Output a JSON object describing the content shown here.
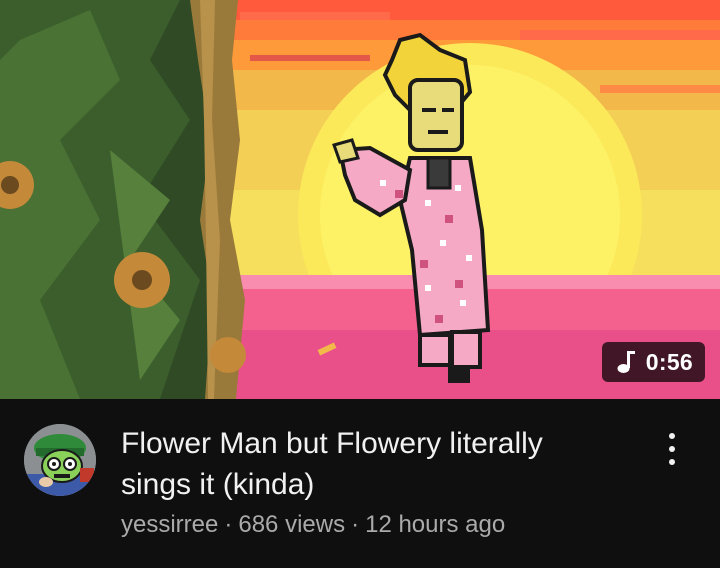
{
  "video": {
    "title": "Flower Man but Flowery literally sings it (kinda)",
    "duration": "0:56",
    "channel": "yessirree",
    "separator": "·",
    "views": "686 views",
    "uploaded": "12 hours ago"
  },
  "icons": {
    "duration_badge_icon": "music-note-icon",
    "menu_icon": "more-vert-icon"
  },
  "colors": {
    "background": "#0f0f0f",
    "title_text": "#f1f1f1",
    "secondary_text": "#aaaaaa",
    "badge_background": "#000000b8"
  }
}
